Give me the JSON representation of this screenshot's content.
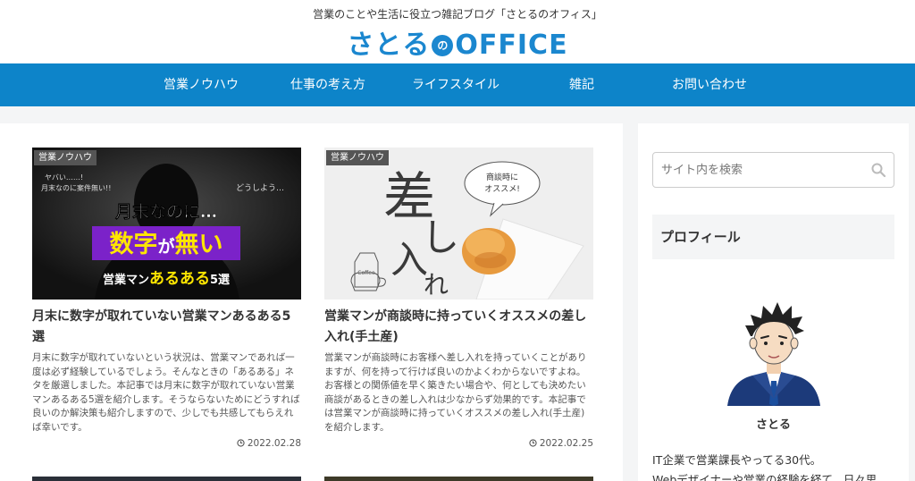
{
  "header": {
    "tagline": "営業のことや生活に役立つ雑記ブログ「さとるのオフィス」",
    "logo_before": "さとる",
    "logo_mark": "の",
    "logo_after": "OFFICE"
  },
  "nav": {
    "items": [
      {
        "label": "営業ノウハウ"
      },
      {
        "label": "仕事の考え方"
      },
      {
        "label": "ライフスタイル"
      },
      {
        "label": "雑記"
      },
      {
        "label": "お問い合わせ"
      }
    ]
  },
  "posts": [
    {
      "category": "営業ノウハウ",
      "thumb_text": {
        "top_note": "ヤバい……!\n月末なのに案件無い!!",
        "side_note": "どうしよう…",
        "line1": "月末なのに…",
        "line2_a": "数字",
        "line2_b": "が",
        "line2_c": "無い",
        "line3_a": "営業マン",
        "line3_b": "あるある",
        "line3_c": "5選"
      },
      "title": "月末に数字が取れていない営業マンあるある5選",
      "snippet": "月末に数字が取れていないという状況は、営業マンであれば一度は必ず経験しているでしょう。そんなときの「あるある」ネタを厳選しました。本記事では月末に数字が取れていない営業マンあるある5選を紹介します。そうならないためにどうすれば良いのか解決策も紹介しますので、少しでも共感してもらえれば幸いです。",
      "date": "2022.02.28"
    },
    {
      "category": "営業ノウハウ",
      "thumb_text": {
        "big1": "差",
        "big2": "し",
        "big3": "入",
        "big4": "れ",
        "bubble": "商談時に\nオススメ!",
        "bag": "Coffee"
      },
      "title": "営業マンが商談時に持っていくオススメの差し入れ(手土産)",
      "snippet": "営業マンが商談時にお客様へ差し入れを持っていくことがありますが、何を持って行けば良いのかよくわからないですよね。お客様との関係値を早く築きたい場合や、何としても決めたい商談があるときの差し入れは少なからず効果的です。本記事では営業マンが商談時に持っていくオススメの差し入れ(手土産)を紹介します。",
      "date": "2022.02.25"
    }
  ],
  "sidebar": {
    "search_placeholder": "サイト内を検索",
    "profile_title": "プロフィール",
    "profile_name": "さとる",
    "bio": "IT企業で営業課長やってる30代。\nWebデザイナーや営業の経験を経て、日々思"
  },
  "icons": {
    "search": "search-icon",
    "clock": "clock-icon"
  },
  "colors": {
    "brand": "#1b87cf",
    "nav_bg": "#0d84c9",
    "category_badge": "#555555",
    "accent_purple": "#7b22c9"
  }
}
